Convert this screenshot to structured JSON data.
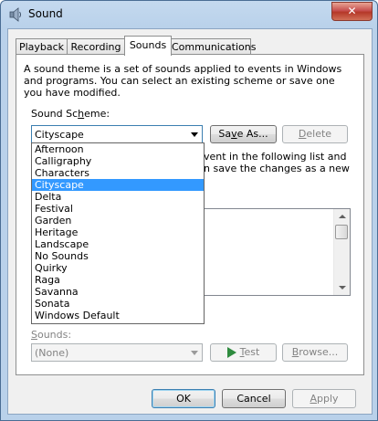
{
  "window": {
    "title": "Sound",
    "close_glyph": "✕"
  },
  "tabs": [
    {
      "label": "Playback",
      "active": false
    },
    {
      "label": "Recording",
      "active": false
    },
    {
      "label": "Sounds",
      "active": true
    },
    {
      "label": "Communications",
      "active": false
    }
  ],
  "sounds_tab": {
    "description": "A sound theme is a set of sounds applied to events in Windows and programs.  You can select an existing scheme or save one you have modified.",
    "scheme_label": "Sound Scheme:",
    "scheme_value": "Cityscape",
    "save_as_label": "Save As...",
    "delete_label": "Delete",
    "partial_text_line1": "vent in the following list and",
    "partial_text_line2": "n save the changes as a new",
    "sounds_label": "Sounds:",
    "sounds_value": "(None)",
    "test_label": "Test",
    "browse_label": "Browse...",
    "scheme_options": [
      "Afternoon",
      "Calligraphy",
      "Characters",
      "Cityscape",
      "Delta",
      "Festival",
      "Garden",
      "Heritage",
      "Landscape",
      "No Sounds",
      "Quirky",
      "Raga",
      "Savanna",
      "Sonata",
      "Windows Default"
    ],
    "selected_option": "Cityscape"
  },
  "footer": {
    "ok_label": "OK",
    "cancel_label": "Cancel",
    "apply_label": "Apply"
  },
  "colors": {
    "selection": "#3399ff",
    "play_icon": "#2e8b3e",
    "close_button": "#c75050"
  },
  "icons": {
    "title": "speaker-icon",
    "test": "play-icon"
  }
}
